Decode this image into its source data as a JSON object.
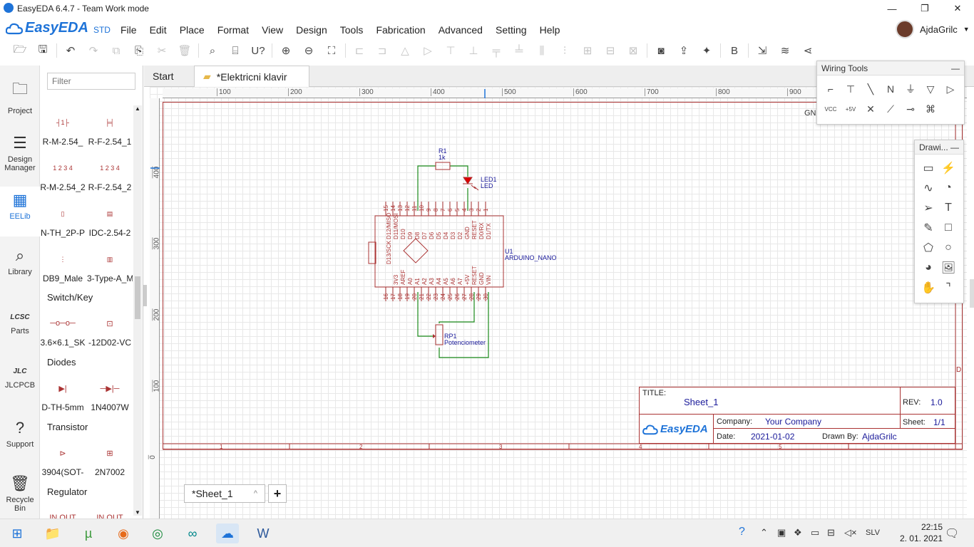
{
  "window": {
    "title": "EasyEDA 6.4.7 - Team Work mode",
    "min": "—",
    "max": "❐",
    "close": "✕"
  },
  "brand": {
    "name": "EasyEDA",
    "edition": "STD"
  },
  "menu": [
    "File",
    "Edit",
    "Place",
    "Format",
    "View",
    "Design",
    "Tools",
    "Fabrication",
    "Advanced",
    "Setting",
    "Help"
  ],
  "user": {
    "name": "AjdaGrilc"
  },
  "toolbar": [
    {
      "icon": "open-folder-icon",
      "glyph": "🗁",
      "enabled": true
    },
    {
      "icon": "save-icon",
      "glyph": "🖫",
      "enabled": true
    },
    {
      "icon": "undo-icon",
      "glyph": "↶",
      "enabled": true
    },
    {
      "icon": "redo-icon",
      "glyph": "↷",
      "enabled": false
    },
    {
      "icon": "copy-icon",
      "glyph": "⧉",
      "enabled": false
    },
    {
      "icon": "paste-icon",
      "glyph": "⎘",
      "enabled": true
    },
    {
      "icon": "cut-icon",
      "glyph": "✂",
      "enabled": false
    },
    {
      "icon": "delete-icon",
      "glyph": "🗑",
      "enabled": false
    },
    {
      "icon": "search-icon",
      "glyph": "⌕",
      "enabled": true
    },
    {
      "icon": "find-icon",
      "glyph": "⌸",
      "enabled": true
    },
    {
      "icon": "annotate-icon",
      "glyph": "U?",
      "enabled": true
    },
    {
      "icon": "zoom-in-icon",
      "glyph": "⊕",
      "enabled": true
    },
    {
      "icon": "zoom-out-icon",
      "glyph": "⊖",
      "enabled": true
    },
    {
      "icon": "fit-icon",
      "glyph": "⛶",
      "enabled": true
    },
    {
      "icon": "align-left-icon",
      "glyph": "⊏",
      "enabled": false
    },
    {
      "icon": "align-right-icon",
      "glyph": "⊐",
      "enabled": false
    },
    {
      "icon": "flip-icon",
      "glyph": "△",
      "enabled": false
    },
    {
      "icon": "rotate-icon",
      "glyph": "▷",
      "enabled": false
    },
    {
      "icon": "align-top-icon",
      "glyph": "⊤",
      "enabled": false
    },
    {
      "icon": "align-bottom-icon",
      "glyph": "⊥",
      "enabled": false
    },
    {
      "icon": "align-h-icon",
      "glyph": "╤",
      "enabled": false
    },
    {
      "icon": "align-v-icon",
      "glyph": "╧",
      "enabled": false
    },
    {
      "icon": "distribute-h-icon",
      "glyph": "⫼",
      "enabled": false
    },
    {
      "icon": "distribute-v-icon",
      "glyph": "⫶",
      "enabled": false
    },
    {
      "icon": "grid-icon",
      "glyph": "⊞",
      "enabled": false
    },
    {
      "icon": "group-icon",
      "glyph": "⊟",
      "enabled": false
    },
    {
      "icon": "ungroup-icon",
      "glyph": "⊠",
      "enabled": false
    },
    {
      "icon": "camera-icon",
      "glyph": "◙",
      "enabled": true
    },
    {
      "icon": "convert-icon",
      "glyph": "⇪",
      "enabled": true
    },
    {
      "icon": "drc-icon",
      "glyph": "✦",
      "enabled": true
    },
    {
      "icon": "bom-icon",
      "glyph": "B",
      "enabled": true
    },
    {
      "icon": "export-icon",
      "glyph": "⇲",
      "enabled": true
    },
    {
      "icon": "layers-icon",
      "glyph": "≋",
      "enabled": true
    },
    {
      "icon": "share-icon",
      "glyph": "⋖",
      "enabled": true
    }
  ],
  "leftnav": [
    {
      "label": "Project",
      "icon": "project-folder-icon",
      "glyph": "🗀"
    },
    {
      "label": "Design Manager",
      "icon": "design-manager-icon",
      "glyph": "☰"
    },
    {
      "label": "EELib",
      "icon": "chip-icon",
      "glyph": "▦",
      "active": true
    },
    {
      "label": "Library",
      "icon": "library-icon",
      "glyph": "⌕"
    },
    {
      "label": "Parts",
      "icon": "lcsc-icon",
      "glyph": "LCSC"
    },
    {
      "label": "JLCPCB",
      "icon": "jlc-icon",
      "glyph": "JLC"
    },
    {
      "label": "Support",
      "icon": "help-icon",
      "glyph": "?"
    },
    {
      "label": "Recycle Bin",
      "icon": "trash-icon",
      "glyph": "🗑"
    }
  ],
  "library": {
    "filter_placeholder": "Filter",
    "rows": [
      {
        "items": [
          {
            "name": "R-M-2.54_",
            "sym": "┤1├"
          },
          {
            "name": "R-F-2.54_1",
            "sym": "╞╡"
          }
        ]
      },
      {
        "items": [
          {
            "name": "R-M-2.54_2",
            "sym": "1 2 3 4"
          },
          {
            "name": "R-F-2.54_2",
            "sym": "1 2 3 4"
          }
        ]
      },
      {
        "items": [
          {
            "name": "N-TH_2P-P",
            "sym": "▯"
          },
          {
            "name": "IDC-2.54-2",
            "sym": "▤"
          }
        ]
      },
      {
        "items": [
          {
            "name": "DB9_Male",
            "sym": "⋮"
          },
          {
            "name": "3-Type-A_M",
            "sym": "▥"
          }
        ]
      }
    ],
    "categories": [
      {
        "title": "Switch/Key",
        "items": [
          {
            "name": "3.6×6.1_SK",
            "sym": "─o─o─"
          },
          {
            "name": "-12D02-VC",
            "sym": "⊡"
          }
        ]
      },
      {
        "title": "Diodes",
        "items": [
          {
            "name": "D-TH-5mm",
            "sym": "▶|"
          },
          {
            "name": "1N4007W",
            "sym": "─▶|─"
          }
        ]
      },
      {
        "title": "Transistor",
        "items": [
          {
            "name": "3904(SOT-",
            "sym": "⊳"
          },
          {
            "name": "2N7002",
            "sym": "⊞"
          }
        ]
      },
      {
        "title": "Regulator",
        "items": [
          {
            "name": "",
            "sym": "IN OUT"
          },
          {
            "name": "",
            "sym": "IN OUT"
          }
        ]
      }
    ]
  },
  "tabs": [
    {
      "label": "Start"
    },
    {
      "label": "*Elektricni klavir",
      "icon": "folder-icon"
    }
  ],
  "rulerH": [
    "100",
    "200",
    "300",
    "400",
    "500",
    "600",
    "700",
    "800",
    "900"
  ],
  "rulerV": [
    "400",
    "300",
    "200",
    "100",
    "0"
  ],
  "frame_cols": [
    "1",
    "2",
    "3",
    "4",
    "5"
  ],
  "frame_side": "D",
  "schematic": {
    "r1": {
      "ref": "R1",
      "val": "1k"
    },
    "led1": {
      "ref": "LED1",
      "val": "LED"
    },
    "u1": {
      "ref": "U1",
      "val": "ARDUINO_NANO"
    },
    "rp1": {
      "ref": "RP1",
      "val": "Potenciometer"
    },
    "top_pins": [
      "15",
      "14",
      "13",
      "12",
      "11",
      "10",
      "9",
      "8",
      "7",
      "6",
      "5",
      "4",
      "3",
      "2",
      "1"
    ],
    "top_names": [
      "D13/SCK",
      "D12/MISO",
      "D11/MOSI",
      "D10",
      "D9",
      "D8",
      "D7",
      "D6",
      "D5",
      "D4",
      "D3",
      "D2",
      "GND",
      "RESET",
      "D0/RX",
      "D1/TX"
    ],
    "bot_pins": [
      "16",
      "17",
      "18",
      "19",
      "20",
      "21",
      "22",
      "23",
      "24",
      "25",
      "26",
      "27",
      "28",
      "29",
      "30"
    ],
    "bot_names": [
      "D13/SCK",
      "3V3",
      "AREF",
      "A0",
      "A1",
      "A2",
      "A3",
      "A4",
      "A5",
      "A6",
      "A7",
      "+5V",
      "RESET",
      "GND",
      "VIN"
    ]
  },
  "titleblock": {
    "title_label": "TITLE:",
    "title": "Sheet_1",
    "rev_label": "REV:",
    "rev": "1.0",
    "company_label": "Company:",
    "company": "Your Company",
    "sheet_label": "Sheet:",
    "sheet": "1/1",
    "date_label": "Date:",
    "date": "2021-01-02",
    "drawn_label": "Drawn By:",
    "drawn": "AjdaGrilc",
    "logo": "EasyEDA"
  },
  "wiring_tools": {
    "title": "Wiring Tools",
    "min": "—",
    "tools": [
      {
        "icon": "wire-icon",
        "glyph": "⌐"
      },
      {
        "icon": "bus-icon",
        "glyph": "⊤"
      },
      {
        "icon": "bus-entry-icon",
        "glyph": "╲"
      },
      {
        "icon": "net-label-icon",
        "glyph": "N"
      },
      {
        "icon": "ground-icon",
        "glyph": "⏚"
      },
      {
        "icon": "gnd-flag-icon",
        "glyph": "▽"
      },
      {
        "icon": "net-port-icon",
        "glyph": "▷"
      },
      {
        "icon": "vcc-icon",
        "glyph": "VCC"
      },
      {
        "icon": "plus5v-icon",
        "glyph": "+5V"
      },
      {
        "icon": "no-connect-icon",
        "glyph": "✕"
      },
      {
        "icon": "probe-icon",
        "glyph": "⟋"
      },
      {
        "icon": "pin-icon",
        "glyph": "⊸"
      },
      {
        "icon": "group-icon",
        "glyph": "⌘"
      }
    ]
  },
  "drawing_tools": {
    "title": "Drawi...",
    "min": "—",
    "tools": [
      {
        "icon": "rect-frame-icon",
        "glyph": "▭"
      },
      {
        "icon": "line-icon",
        "glyph": "⚡"
      },
      {
        "icon": "bezier-icon",
        "glyph": "∿"
      },
      {
        "icon": "arc-icon",
        "glyph": "◔"
      },
      {
        "icon": "arrow-icon",
        "glyph": "➢"
      },
      {
        "icon": "text-icon",
        "glyph": "T"
      },
      {
        "icon": "pencil-icon",
        "glyph": "✎"
      },
      {
        "icon": "rect-icon",
        "glyph": "□"
      },
      {
        "icon": "polygon-icon",
        "glyph": "⬠"
      },
      {
        "icon": "circle-icon",
        "glyph": "○"
      },
      {
        "icon": "pie-icon",
        "glyph": "◕"
      },
      {
        "icon": "image-icon",
        "glyph": "🖼"
      },
      {
        "icon": "hand-icon",
        "glyph": "✋"
      },
      {
        "icon": "dimension-icon",
        "glyph": "⌝"
      }
    ]
  },
  "sheet_tabs": {
    "current": "*Sheet_1",
    "caret": "^",
    "add": "+"
  },
  "gnd_text": "GN",
  "taskbar": {
    "apps": [
      {
        "icon": "windows-start-icon",
        "glyph": "⊞"
      },
      {
        "icon": "file-explorer-icon",
        "glyph": "📁"
      },
      {
        "icon": "utorrent-icon",
        "glyph": "µ"
      },
      {
        "icon": "firefox-icon",
        "glyph": "◉"
      },
      {
        "icon": "chrome-icon",
        "glyph": "◎"
      },
      {
        "icon": "arduino-icon",
        "glyph": "∞"
      },
      {
        "icon": "easyeda-icon",
        "glyph": "☁"
      },
      {
        "icon": "word-icon",
        "glyph": "W"
      }
    ],
    "lang": "SLV",
    "time": "22:15",
    "date": "2. 01. 2021"
  },
  "colors": {
    "accent": "#1e73d8",
    "frame": "#a33333",
    "wire": "#1a8a1a",
    "part": "#a33333",
    "text": "#1a1a9a"
  }
}
